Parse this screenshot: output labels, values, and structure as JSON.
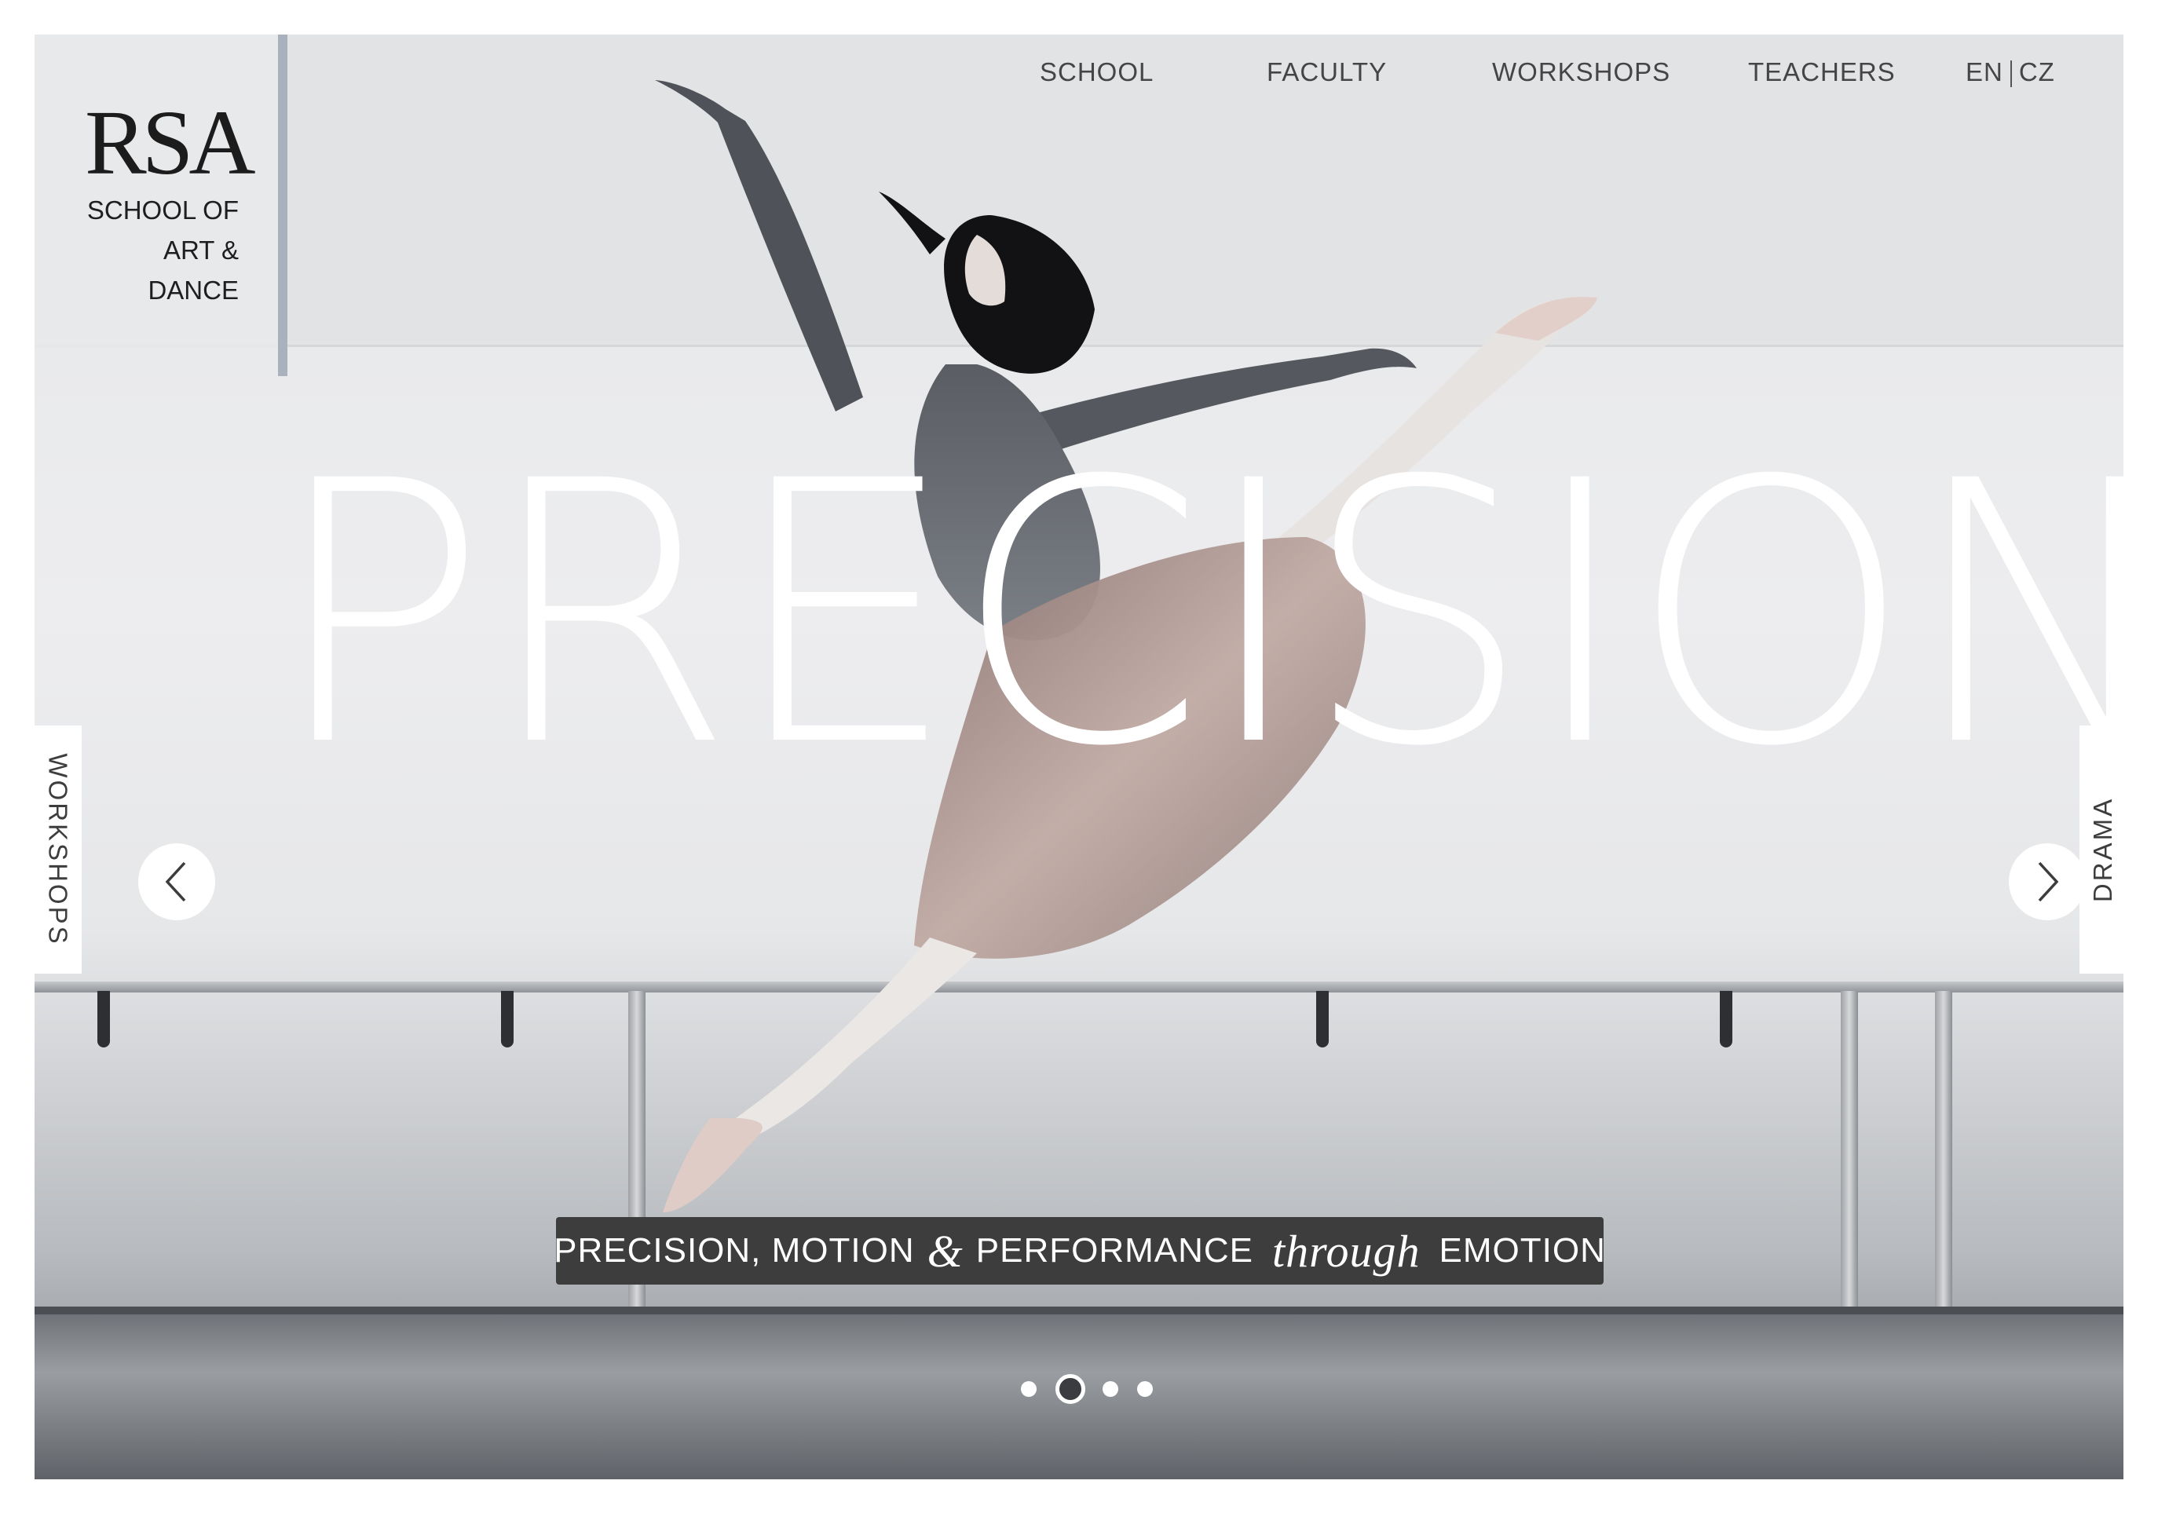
{
  "logo": {
    "mark": "RSA",
    "subtitle_line1": "SCHOOL OF",
    "subtitle_line2": "ART &",
    "subtitle_line3": "DANCE"
  },
  "nav": {
    "items": [
      {
        "label": "SCHOOL"
      },
      {
        "label": "FACULTY"
      },
      {
        "label": "WORKSHOPS"
      },
      {
        "label": "TEACHERS"
      }
    ],
    "lang_en": "EN",
    "lang_cz": "CZ"
  },
  "hero": {
    "headline": "PRECISION",
    "left_tab": "WORKSHOPS",
    "right_tab": "DRAMA",
    "prev_icon": "chevron-left-icon",
    "next_icon": "chevron-right-icon",
    "image_subject": "ballet-dancer-leaping-photo"
  },
  "tagline": {
    "part1": "PRECISION, MOTION",
    "amp": "&",
    "part2": "PERFORMANCE",
    "through": "through",
    "part3": "EMOTION"
  },
  "carousel": {
    "slide_count": 4,
    "active_index": 1
  },
  "colors": {
    "logo_rule": "#a9b1bd",
    "tagline_bg": "#3d3d3d",
    "headline": "#ffffff"
  }
}
